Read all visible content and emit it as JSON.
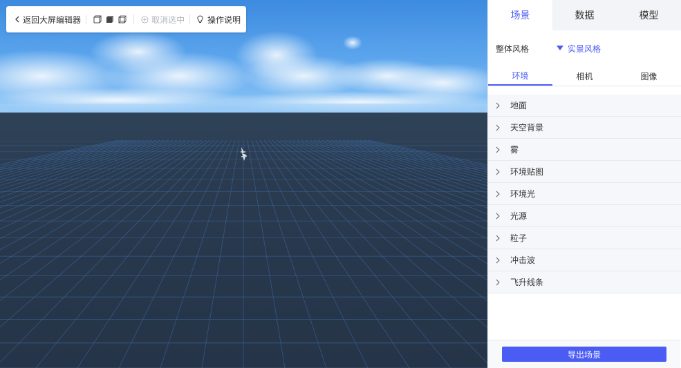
{
  "toolbar": {
    "back_label": "返回大屏编辑器",
    "cancel_select_label": "取消选中",
    "help_label": "操作说明"
  },
  "panel": {
    "main_tabs": [
      {
        "label": "场景",
        "active": true
      },
      {
        "label": "数据",
        "active": false
      },
      {
        "label": "模型",
        "active": false
      }
    ],
    "style_label": "整体风格",
    "style_value": "实景风格",
    "sub_tabs": [
      {
        "label": "环境",
        "active": true
      },
      {
        "label": "相机",
        "active": false
      },
      {
        "label": "图像",
        "active": false
      }
    ],
    "sections": [
      "地面",
      "天空背景",
      "雾",
      "环境贴图",
      "环境光",
      "光源",
      "粒子",
      "冲击波",
      "飞升线条"
    ],
    "export_label": "导出场景"
  },
  "colors": {
    "accent": "#4a5cf4",
    "sky_top": "#3f8fe0",
    "horizon": "#8cc4f4",
    "ground": "#27384c",
    "grid": "#3d6fae"
  },
  "icons": {
    "back": "chevron-left-icon",
    "cube_a": "cube-outline-icon",
    "cube_b": "cube-filled-icon",
    "cube_c": "cube-wire-icon",
    "cancel": "plus-circle-icon",
    "help": "lightbulb-icon",
    "dropdown": "triangle-down-icon",
    "section": "chevron-right-icon"
  }
}
